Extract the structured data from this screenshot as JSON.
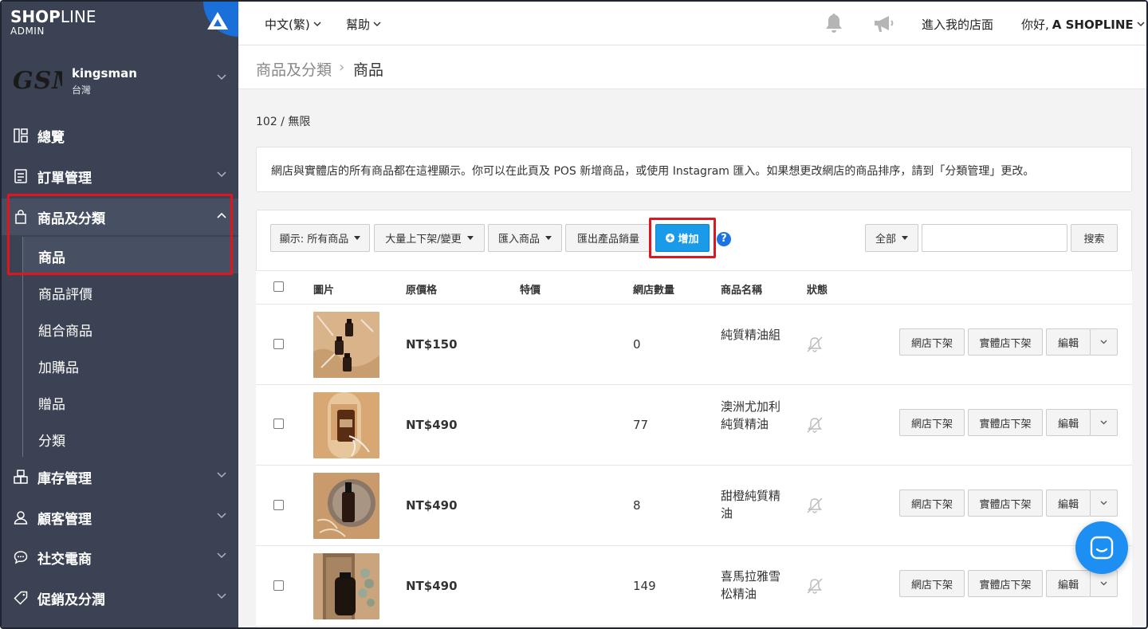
{
  "brand": {
    "logo_bold": "SHOP",
    "logo_light": "LINE",
    "admin": "ADMIN"
  },
  "store": {
    "logo_text": "GSM",
    "name": "kingsman",
    "region": "台灣"
  },
  "sidebar": {
    "items": [
      {
        "label": "總覽",
        "icon": "dashboard-icon"
      },
      {
        "label": "訂單管理",
        "icon": "orders-icon"
      },
      {
        "label": "商品及分類",
        "icon": "shopping-bag-icon"
      },
      {
        "label": "庫存管理",
        "icon": "inventory-icon"
      },
      {
        "label": "顧客管理",
        "icon": "user-icon"
      },
      {
        "label": "社交電商",
        "icon": "chat-bubble-icon"
      },
      {
        "label": "促銷及分潤",
        "icon": "tag-icon"
      }
    ],
    "sub_items": [
      "商品",
      "商品評價",
      "組合商品",
      "加購品",
      "贈品",
      "分類"
    ]
  },
  "topbar": {
    "language": "中文(繁)",
    "help": "幫助",
    "visit_store": "進入我的店面",
    "greeting_prefix": "你好, ",
    "greeting_name": "A SHOPLINE"
  },
  "breadcrumb": {
    "parent": "商品及分類",
    "separator": "›",
    "current": "商品"
  },
  "product_count": "102 / 無限",
  "info_text": "網店與實體店的所有商品都在這裡顯示。你可以在此頁及 POS 新增商品，或使用 Instagram 匯入。如果想更改網店的商品排序，請到「分類管理」更改。",
  "toolbar": {
    "display_filter": "顯示: 所有商品",
    "bulk_action": "大量上下架/變更",
    "import": "匯入商品",
    "export_sales": "匯出產品銷量",
    "add": "增加",
    "help": "?",
    "scope": "全部",
    "search_button": "搜索",
    "search_placeholder": ""
  },
  "table": {
    "headers": [
      "圖片",
      "原價格",
      "特價",
      "網店數量",
      "商品名稱",
      "狀態"
    ],
    "rows": [
      {
        "price": "NT$150",
        "sale": "",
        "qty": "0",
        "name": "純質精油組"
      },
      {
        "price": "NT$490",
        "sale": "",
        "qty": "77",
        "name": "澳洲尤加利純質精油"
      },
      {
        "price": "NT$490",
        "sale": "",
        "qty": "8",
        "name": "甜橙純質精油"
      },
      {
        "price": "NT$490",
        "sale": "",
        "qty": "149",
        "name": "喜馬拉雅雪松精油"
      }
    ],
    "row_actions": {
      "online_off": "網店下架",
      "retail_off": "實體店下架",
      "edit": "編輯"
    }
  },
  "colors": {
    "sidebar": "#3b4254",
    "primary": "#1a9bea",
    "highlight": "#e0161e",
    "chat": "#1d8ff2"
  }
}
